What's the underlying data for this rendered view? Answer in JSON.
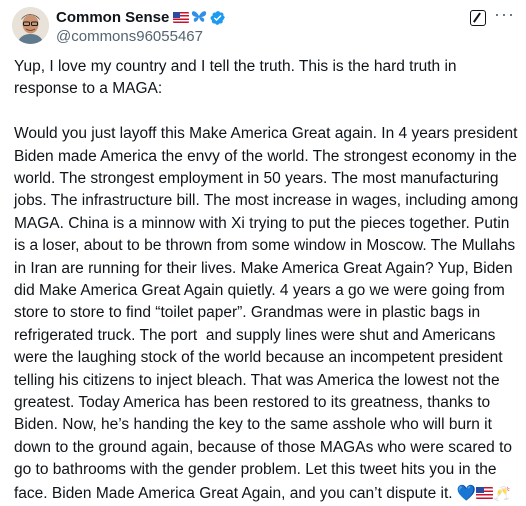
{
  "author": {
    "display_name": "Common Sense",
    "handle": "@commons96055467",
    "badges": [
      "us-flag-icon",
      "butterfly-icon",
      "verified-badge-icon"
    ]
  },
  "actions": {
    "grok_icon": "grok-icon",
    "more_icon": "more-options-icon",
    "more_label": "···"
  },
  "tweet": {
    "paragraph1": "Yup, I love my country and I tell the truth. This is the hard truth in response to a MAGA:",
    "paragraph2": "Would you just layoff this Make America Great again. In 4 years president Biden made America the envy of the world. The strongest economy in the world. The strongest employment in 50 years. The most manufacturing jobs. The infrastructure bill. The most increase in wages, including among MAGA. China is a minnow with Xi trying to put the pieces together. Putin is a loser, about to be thrown from some window in Moscow. The Mullahs in Iran are running for their lives. Make America Great Again? Yup, Biden did Make America Great Again quietly. 4 years a go we were going from store to store to find “toilet paper”. Grandmas were in plastic bags in refrigerated truck. The port  and supply lines were shut and Americans were the laughing stock of the world because an incompetent president telling his citizens to inject bleach. That was America the lowest not the greatest. Today America has been restored to its greatness, thanks to Biden. Now, he’s handing the key to the same asshole who will burn it down to the ground again, because of those MAGAs who were scared to go to bathrooms with the gender problem. Let this tweet hits you in the face. Biden Made America Great Again, and you can’t dispute it.",
    "trailing_emojis": [
      "blue-heart",
      "us-flag",
      "clinking-glasses"
    ],
    "heart_char": "💙",
    "clink_char": "🥂"
  },
  "colors": {
    "verified_blue": "#1d9bf0",
    "text": "#0f1419",
    "secondary_text": "#536471"
  }
}
